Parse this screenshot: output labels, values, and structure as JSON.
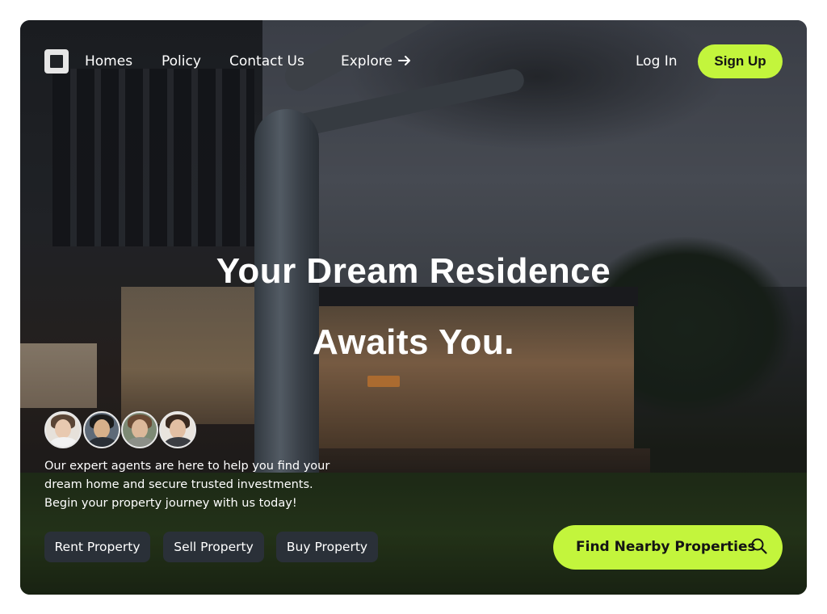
{
  "nav": {
    "links": [
      "Homes",
      "Policy",
      "Contact Us",
      "Explore"
    ],
    "login_label": "Log In",
    "signup_label": "Sign Up"
  },
  "hero": {
    "headline_line1": "Your Dream Residence",
    "headline_line2": "Awaits You.",
    "description_lines": [
      "Our expert agents are here to help you find your",
      "dream home and secure trusted investments.",
      "Begin your property journey with us today!"
    ],
    "actions": [
      "Rent Property",
      "Sell Property",
      "Buy Property"
    ],
    "find_label": "Find Nearby Properties"
  },
  "colors": {
    "accent": "#c3f53c",
    "pill_bg": "#2a3038",
    "text": "#ffffff"
  },
  "icons": {
    "logo": "square-logo-icon",
    "explore": "arrow-right-icon",
    "find": "search-icon"
  }
}
